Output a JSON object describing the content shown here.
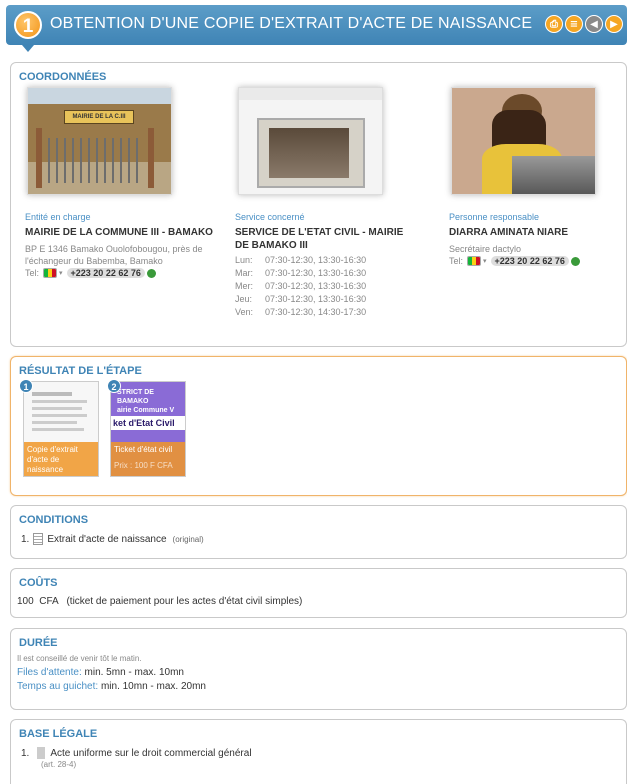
{
  "header": {
    "step": "1",
    "title": "OBTENTION D'UNE COPIE D'EXTRAIT D'ACTE DE NAISSANCE",
    "icons": [
      "print-icon",
      "list-icon",
      "back-icon",
      "next-icon"
    ]
  },
  "coordonnees": {
    "title": "COORDONNÉES",
    "entite": {
      "label": "Entité en charge",
      "name": "MAIRIE DE LA COMMUNE III - BAMAKO",
      "address": "BP E 1346 Bamako Ouolofobougou, près de l'échangeur du Babemba, Bamako",
      "tel_label": "Tel:",
      "tel": "+223 20 22 62 76",
      "sign_text": "MAIRIE DE LA C.III"
    },
    "service": {
      "label": "Service concerné",
      "name": "SERVICE DE L'ETAT CIVIL - MAIRIE DE BAMAKO III",
      "hours": [
        {
          "day": "Lun:",
          "time": "07:30-12:30, 13:30-16:30"
        },
        {
          "day": "Mar:",
          "time": "07:30-12:30, 13:30-16:30"
        },
        {
          "day": "Mer:",
          "time": "07:30-12:30, 13:30-16:30"
        },
        {
          "day": "Jeu:",
          "time": "07:30-12:30, 13:30-16:30"
        },
        {
          "day": "Ven:",
          "time": "07:30-12:30, 14:30-17:30"
        }
      ]
    },
    "personne": {
      "label": "Personne responsable",
      "name": "DIARRA AMINATA NIARE",
      "role": "Secrétaire dactylo",
      "tel_label": "Tel:",
      "tel": "+223 20 22 62 76"
    }
  },
  "resultat": {
    "title": "RÉSULTAT DE L'ÉTAPE",
    "items": [
      {
        "num": "1",
        "caption": "Copie d'extrait d'acte de naissance"
      },
      {
        "num": "2",
        "caption": "Ticket d'état civil",
        "top_text_1": "STRICT DE BAMAKO",
        "top_text_2": "airie Commune V",
        "mid_text": "ket d'Etat Civil",
        "bottom_text": "Prix : 100 F CFA"
      }
    ]
  },
  "conditions": {
    "title": "CONDITIONS",
    "items": [
      {
        "num": "1.",
        "text": "Extrait d'acte de naissance",
        "note": "(original)"
      }
    ]
  },
  "couts": {
    "title": "COÛTS",
    "text": "100  CFA   (ticket de paiement pour les actes d'état civil simples)"
  },
  "duree": {
    "title": "DURÉE",
    "note": "Il est conseillé de venir tôt le matin.",
    "lines": [
      {
        "label": "Files d'attente:",
        "value": "min. 5mn - max. 10mn"
      },
      {
        "label": "Temps au guichet:",
        "value": "min. 10mn - max. 20mn"
      }
    ]
  },
  "base": {
    "title": "BASE LÉGALE",
    "items": [
      {
        "num": "1.",
        "text": "Acte uniforme sur le droit commercial général",
        "note": "(art. 28-4)"
      }
    ]
  },
  "colors": {
    "accent": "#3f84b5",
    "orange": "#f29419"
  }
}
